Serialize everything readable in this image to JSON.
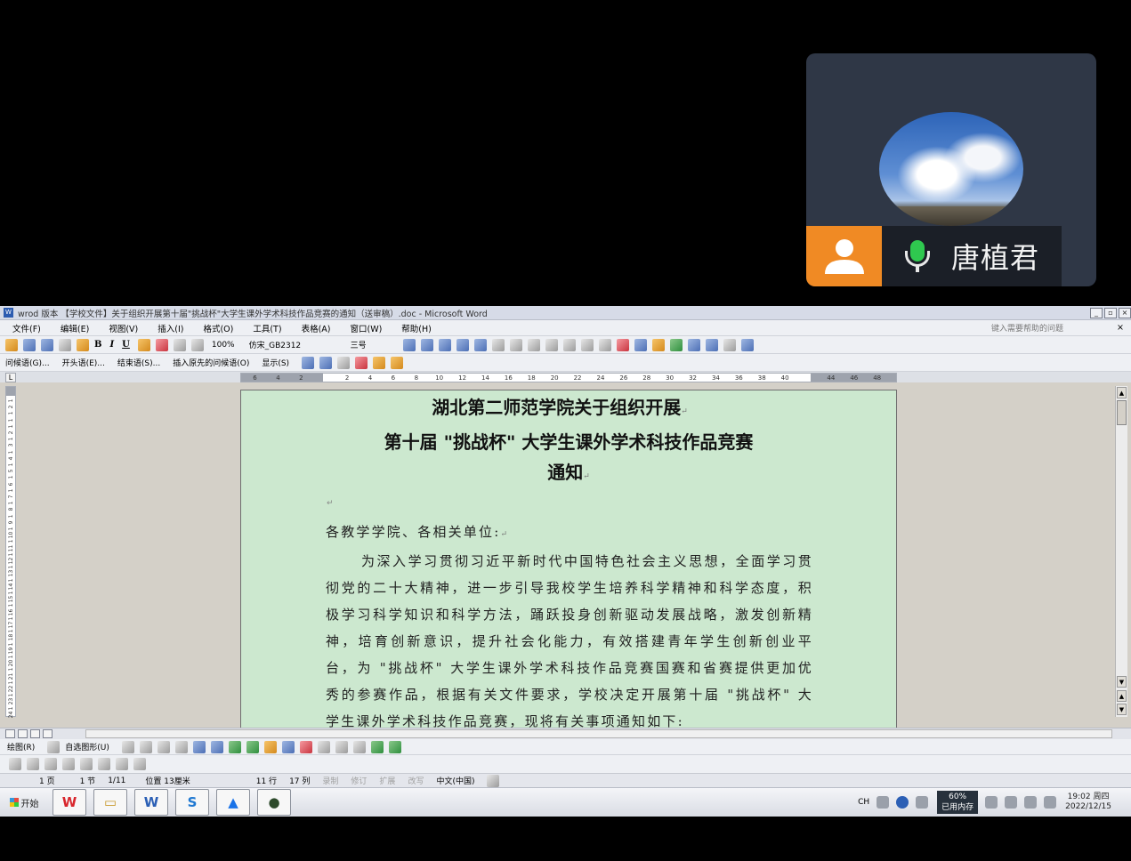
{
  "participant": {
    "name": "唐植君",
    "person_icon": "person-icon",
    "mic_icon": "microphone-icon",
    "mic_color": "#2fc84f",
    "accent": "#f08a24"
  },
  "window": {
    "title": "wrod 版本 【学校文件】关于组织开展第十届\"挑战杯\"大学生课外学术科技作品竞赛的通知（送审稿）.doc - Microsoft Word",
    "minimize": "_",
    "restore": "▫",
    "close": "×"
  },
  "menu": {
    "items": [
      "文件(F)",
      "编辑(E)",
      "视图(V)",
      "插入(I)",
      "格式(O)",
      "工具(T)",
      "表格(A)",
      "窗口(W)",
      "帮助(H)"
    ],
    "help_placeholder": "键入需要帮助的问题",
    "close_doc": "×"
  },
  "toolbar": {
    "bold": "B",
    "italic": "I",
    "underline": "U",
    "zoom": "100%",
    "font": "仿宋_GB2312",
    "size": "三号"
  },
  "reviewbar": {
    "items": [
      "问候语(G)...",
      "开头语(E)...",
      "结束语(S)...",
      "插入原先的问候语(O)"
    ],
    "show": "显示(S)"
  },
  "ruler": {
    "labels": [
      "6",
      "4",
      "2",
      "",
      "2",
      "4",
      "6",
      "8",
      "10",
      "12",
      "14",
      "16",
      "18",
      "20",
      "22",
      "24",
      "26",
      "28",
      "30",
      "32",
      "34",
      "36",
      "38",
      "40",
      "",
      "44",
      "46",
      "48"
    ]
  },
  "vruler": {
    "labels": [
      "1",
      "2",
      "1",
      "1",
      "1",
      "2",
      "1",
      "3",
      "1",
      "4",
      "1",
      "5",
      "1",
      "6",
      "1",
      "7",
      "1",
      "8",
      "1",
      "9",
      "1",
      "10",
      "1",
      "11",
      "1",
      "12",
      "1",
      "13",
      "1",
      "14",
      "1",
      "15",
      "1",
      "16",
      "1",
      "17",
      "1",
      "18",
      "1",
      "19",
      "1",
      "20",
      "1",
      "21",
      "1",
      "22",
      "1",
      "23",
      "1",
      "24"
    ]
  },
  "document": {
    "title_line1": "湖北第二师范学院关于组织开展",
    "title_line2": "第十届 \"挑战杯\" 大学生课外学术科技作品竞赛",
    "title_line3": "通知",
    "para_mark": "↵",
    "salutation": "各教学学院、各相关单位:",
    "paragraph": "为深入学习贯彻习近平新时代中国特色社会主义思想，全面学习贯彻党的二十大精神，进一步引导我校学生培养科学精神和科学态度，积极学习科学知识和科学方法，踊跃投身创新驱动发展战略，激发创新精神，培育创新意识，提升社会化能力，有效搭建青年学生创新创业平台，为 \"挑战杯\" 大学生课外学术科技作品竞赛国赛和省赛提供更加优秀的参赛作品，根据有关文件要求，学校决定开展第十届 \"挑战杯\" 大学生课外学术科技作品竞赛，现将有关事项通知如下:"
  },
  "drawbar": {
    "draw": "绘图(R)",
    "autoshapes": "自选图形(U)"
  },
  "status": {
    "page": "1 页",
    "section": "1 节",
    "pages": "1/11",
    "position": "位置 13厘米",
    "line": "11 行",
    "col": "17 列",
    "rec": "录制",
    "trk": "修订",
    "ext": "扩展",
    "ovr": "改写",
    "lang": "中文(中国)"
  },
  "taskbar": {
    "start": "开始",
    "apps": [
      "W",
      "▭",
      "W",
      "S",
      "▲",
      "●"
    ],
    "lang": "CH",
    "mem_pct": "60%",
    "mem_label": "已用内存",
    "time": "19:02 周四",
    "date": "2022/12/15"
  }
}
